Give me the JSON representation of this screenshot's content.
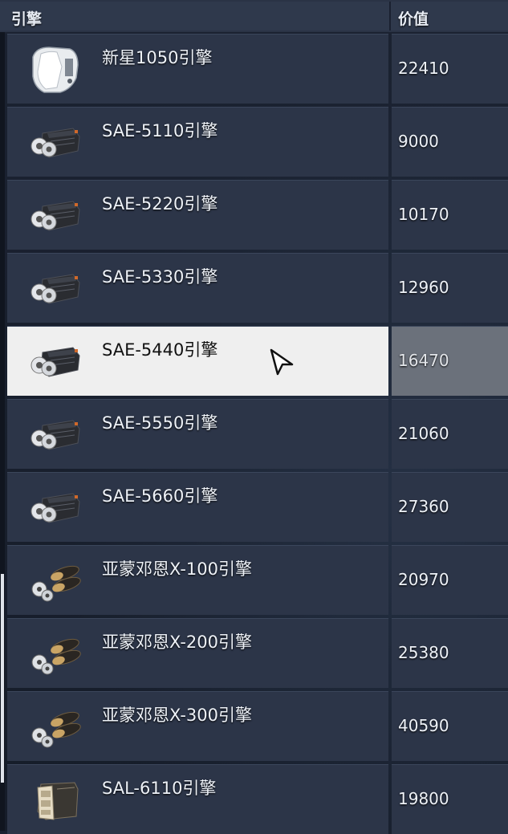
{
  "table": {
    "header_name": "引擎",
    "header_value": "价值",
    "rows": [
      {
        "name": "新星1050引擎",
        "value": "22410",
        "icon": "nova-engine-icon"
      },
      {
        "name": "SAE-5110引擎",
        "value": "9000",
        "icon": "sae-engine-icon"
      },
      {
        "name": "SAE-5220引擎",
        "value": "10170",
        "icon": "sae-engine-icon"
      },
      {
        "name": "SAE-5330引擎",
        "value": "12960",
        "icon": "sae-engine-icon"
      },
      {
        "name": "SAE-5440引擎",
        "value": "16470",
        "icon": "sae-engine-icon",
        "selected": true
      },
      {
        "name": "SAE-5550引擎",
        "value": "21060",
        "icon": "sae-engine-icon"
      },
      {
        "name": "SAE-5660引擎",
        "value": "27360",
        "icon": "sae-engine-icon"
      },
      {
        "name": "亚蒙邓恩X-100引擎",
        "value": "20970",
        "icon": "yamondun-engine-icon"
      },
      {
        "name": "亚蒙邓恩X-200引擎",
        "value": "25380",
        "icon": "yamondun-engine-icon"
      },
      {
        "name": "亚蒙邓恩X-300引擎",
        "value": "40590",
        "icon": "yamondun-engine-icon"
      },
      {
        "name": "SAL-6110引擎",
        "value": "19800",
        "icon": "sal-engine-icon"
      }
    ]
  },
  "colors": {
    "row_bg": "#2c3548",
    "selected_bg": "#efefef",
    "selected_value_bg": "#6b717b",
    "text": "#eef2f8"
  }
}
